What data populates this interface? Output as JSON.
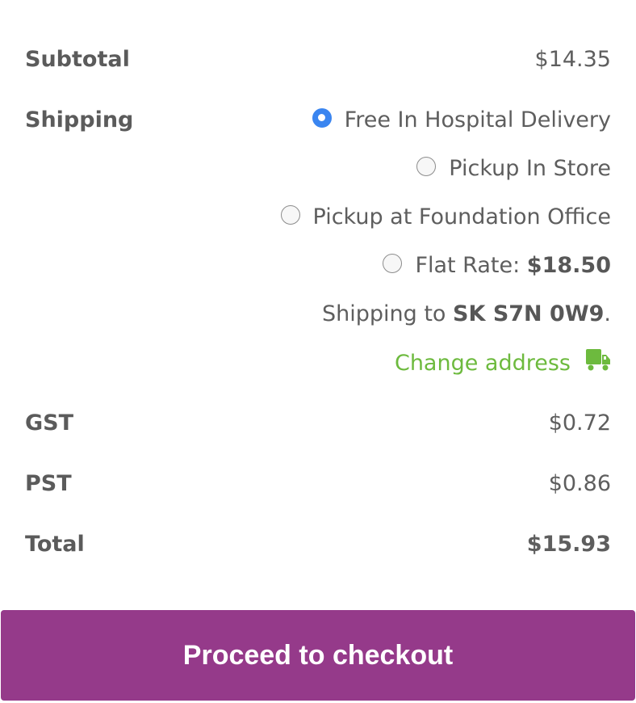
{
  "subtotal": {
    "label": "Subtotal",
    "value": "$14.35"
  },
  "shipping": {
    "label": "Shipping",
    "options": [
      {
        "label": "Free In Hospital Delivery",
        "checked": true
      },
      {
        "label": "Pickup In Store",
        "checked": false
      },
      {
        "label": "Pickup at Foundation Office",
        "checked": false
      },
      {
        "label": "Flat Rate:",
        "price": "$18.50",
        "checked": false
      }
    ],
    "destination_prefix": "Shipping to",
    "destination": "SK S7N 0W9",
    "destination_suffix": ".",
    "change_address_label": "Change address",
    "change_address_icon": "truck-icon"
  },
  "gst": {
    "label": "GST",
    "value": "$0.72"
  },
  "pst": {
    "label": "PST",
    "value": "$0.86"
  },
  "total": {
    "label": "Total",
    "value": "$15.93"
  },
  "checkout_button": "Proceed to checkout",
  "colors": {
    "accent_button": "#953a8a",
    "link_green": "#6dba3e",
    "radio_blue": "#3a85f0"
  }
}
